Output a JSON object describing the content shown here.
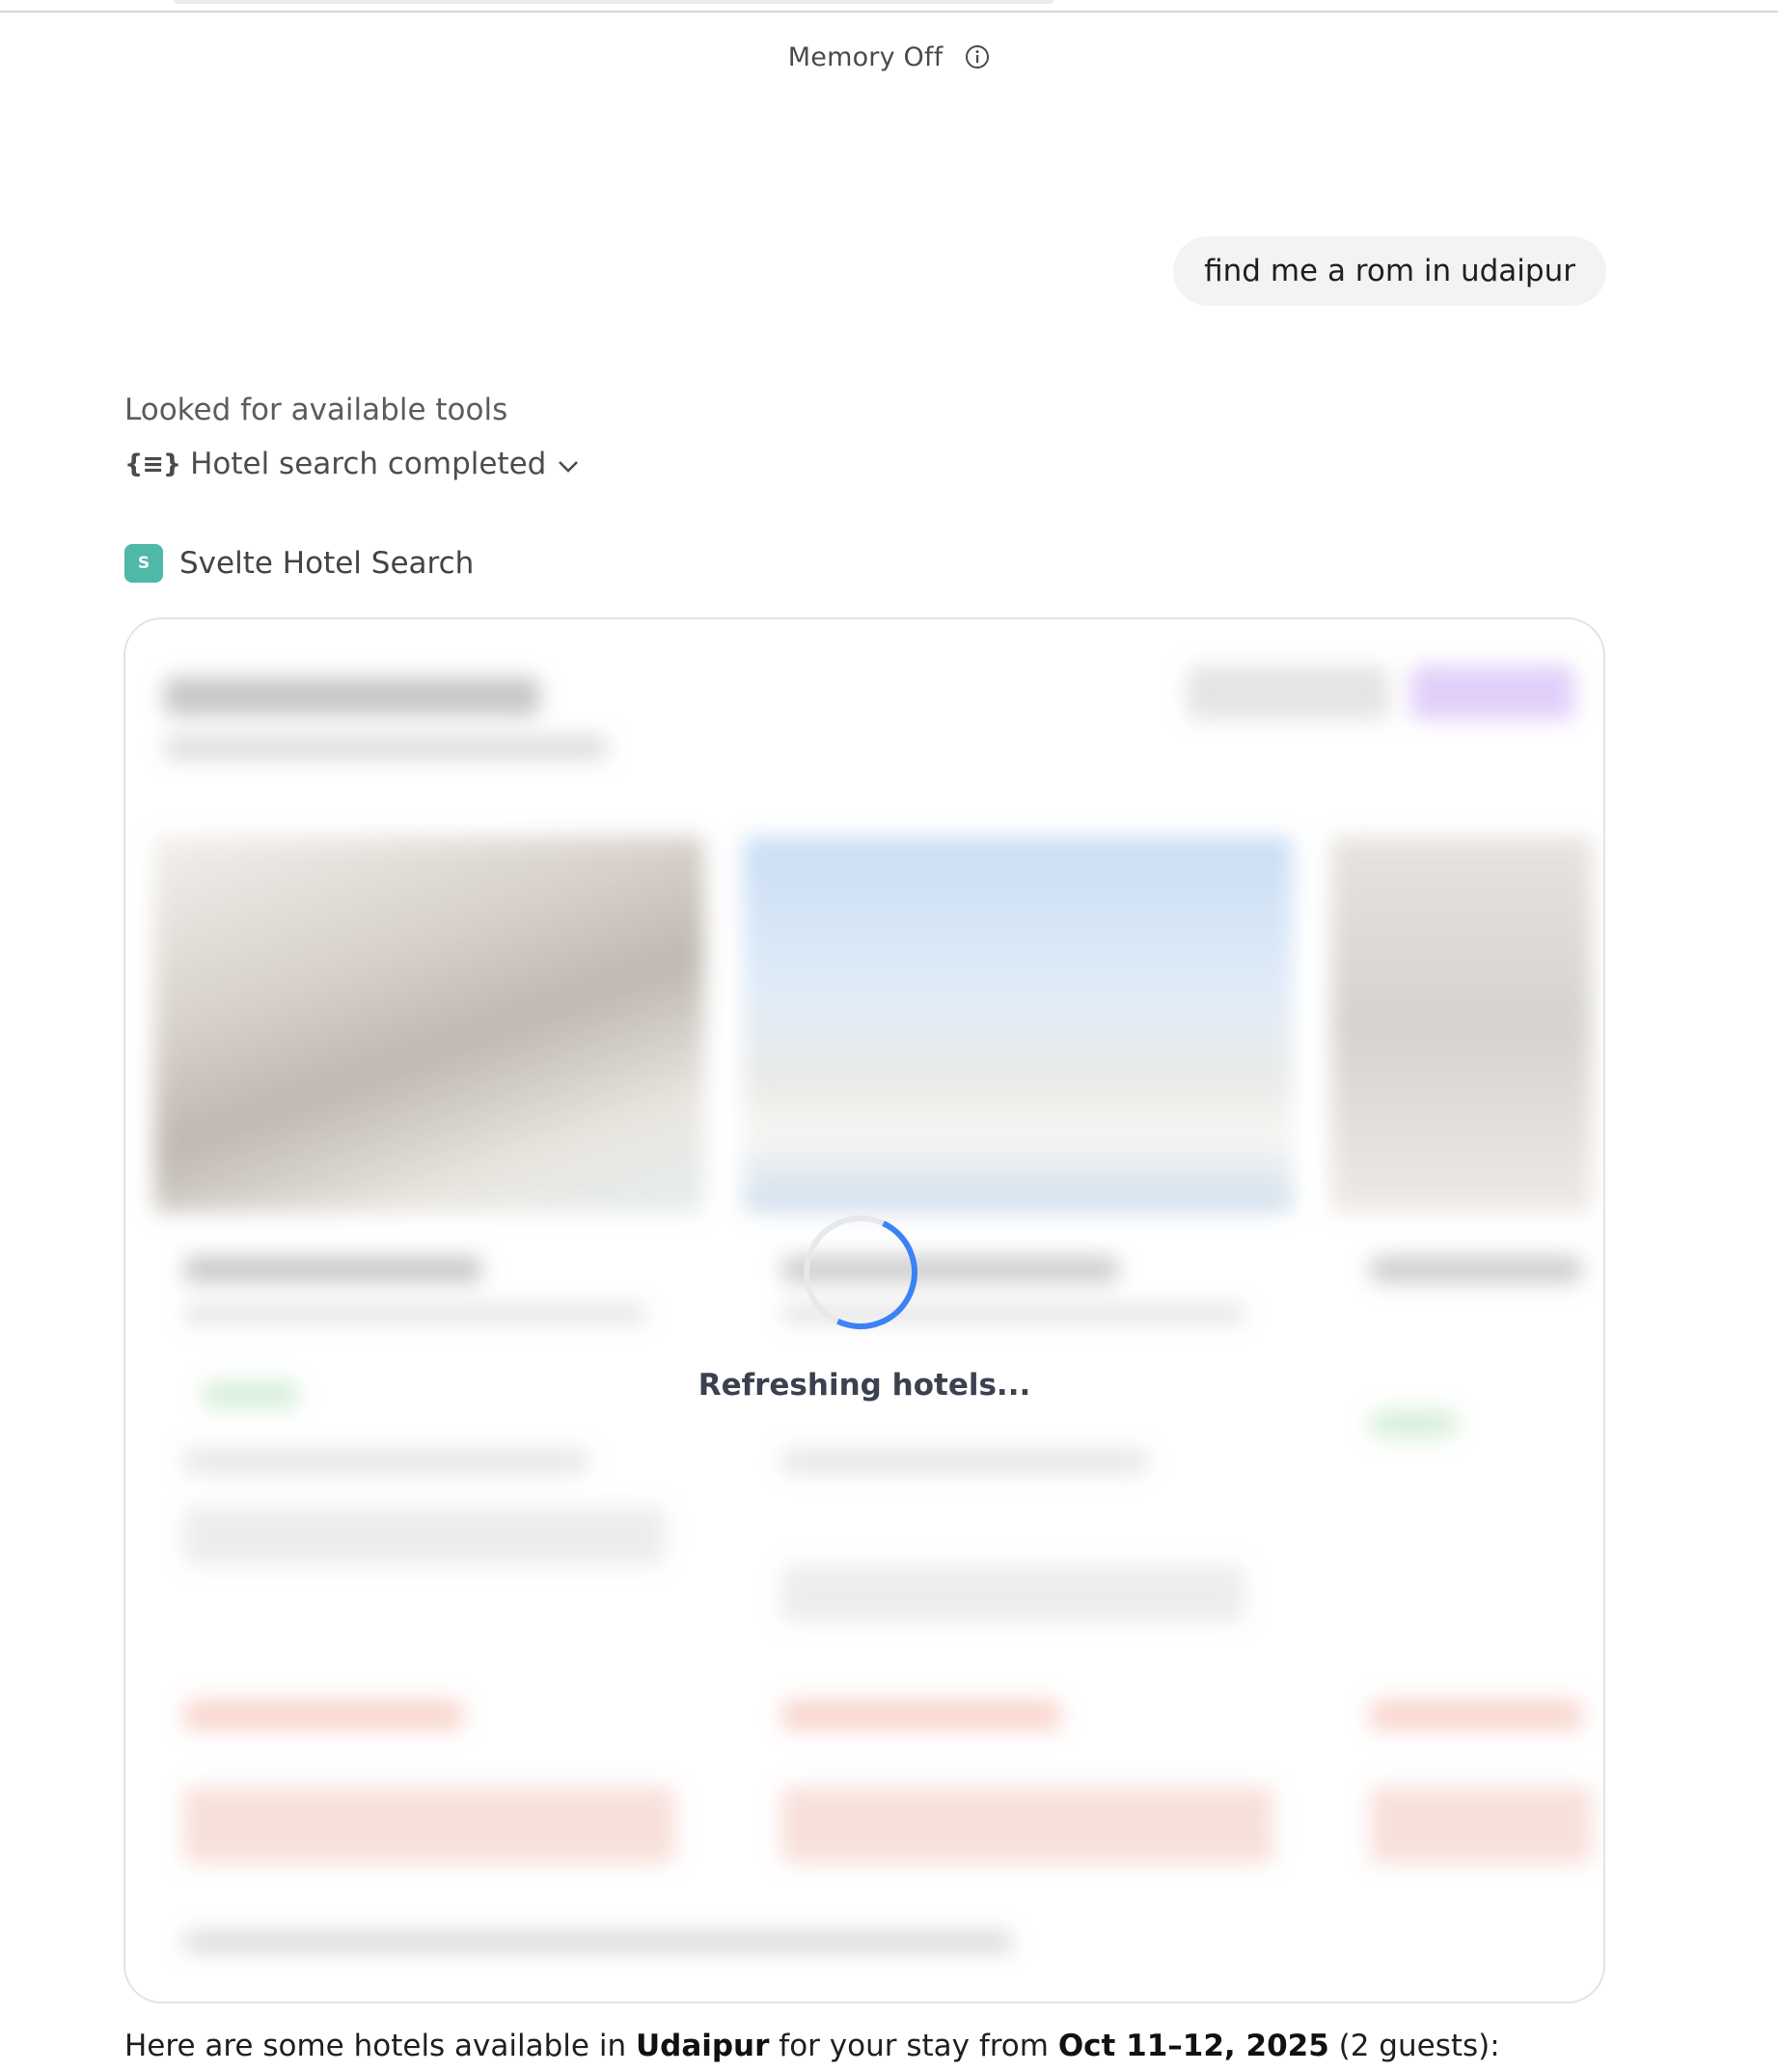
{
  "header": {
    "memory_status": "Memory Off",
    "info_icon": "info-icon"
  },
  "conversation": {
    "user_message": "find me a rom in udaipur",
    "tool_lookup_text": "Looked for available tools",
    "tool_status": {
      "icon": "code-braces-icon",
      "label": "Hotel search completed",
      "expand_icon": "chevron-down-icon"
    },
    "app": {
      "badge_letter": "S",
      "badge_color": "#4fb8a8",
      "name": "Svelte Hotel Search"
    }
  },
  "widget": {
    "loading_text": "Refreshing hotels...",
    "spinner_color": "#3b82f6"
  },
  "response": {
    "prefix": "Here are some hotels available in ",
    "city": "Udaipur",
    "middle": " for your stay from ",
    "dates": "Oct 11–12, 2025",
    "suffix": " (2 guests):"
  }
}
